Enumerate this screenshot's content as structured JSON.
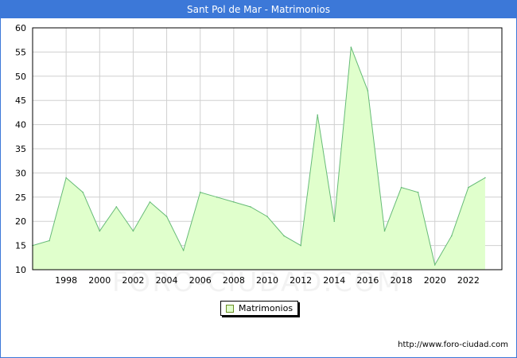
{
  "title": "Sant Pol de Mar - Matrimonios",
  "credit": "http://www.foro-ciudad.com",
  "watermark": "FORO-CIUDAD.COM",
  "colors": {
    "header": "#3c78d8",
    "area_fill": "#e0ffcc",
    "area_line": "#66bb77",
    "grid": "#d0d0d0"
  },
  "chart_data": {
    "type": "area",
    "title": "Sant Pol de Mar - Matrimonios",
    "xlabel": "",
    "ylabel": "",
    "x": [
      1996,
      1997,
      1998,
      1999,
      2000,
      2001,
      2002,
      2003,
      2004,
      2005,
      2006,
      2007,
      2008,
      2009,
      2010,
      2011,
      2012,
      2013,
      2014,
      2015,
      2016,
      2017,
      2018,
      2019,
      2020,
      2021,
      2022,
      2023
    ],
    "series": [
      {
        "name": "Matrimonios",
        "values": [
          15,
          16,
          29,
          26,
          18,
          23,
          18,
          24,
          21,
          14,
          26,
          25,
          24,
          23,
          21,
          17,
          15,
          42,
          20,
          56,
          47,
          18,
          27,
          26,
          11,
          17,
          27,
          29
        ]
      }
    ],
    "xlim": [
      1996,
      2024
    ],
    "ylim": [
      10,
      60
    ],
    "xticks": [
      "1998",
      "2000",
      "2002",
      "2004",
      "2006",
      "2008",
      "2010",
      "2012",
      "2014",
      "2016",
      "2018",
      "2020",
      "2022"
    ],
    "yticks": [
      "10",
      "15",
      "20",
      "25",
      "30",
      "35",
      "40",
      "45",
      "50",
      "55",
      "60"
    ],
    "grid": true,
    "legend": "bottom-center"
  }
}
